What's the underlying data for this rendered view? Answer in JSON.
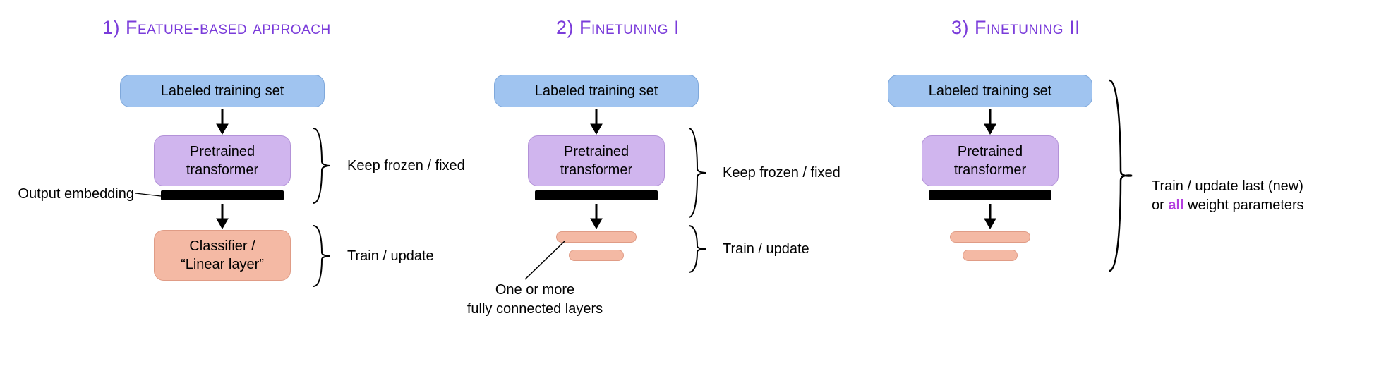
{
  "titles": {
    "p1": "1) Feature-based approach",
    "p2": "2) Finetuning I",
    "p3": "3) Finetuning II"
  },
  "boxes": {
    "training_set": "Labeled training set",
    "pretrained": "Pretrained\ntransformer",
    "classifier": "Classifier /\n“Linear layer”"
  },
  "labels": {
    "output_embedding": "Output embedding",
    "keep_frozen": "Keep frozen / fixed",
    "train_update": "Train / update",
    "fc_layers": "One or more\nfully connected layers",
    "train_all_pre": "Train / update last (new)\nor ",
    "train_all_highlight": "all",
    "train_all_post": " weight parameters"
  }
}
